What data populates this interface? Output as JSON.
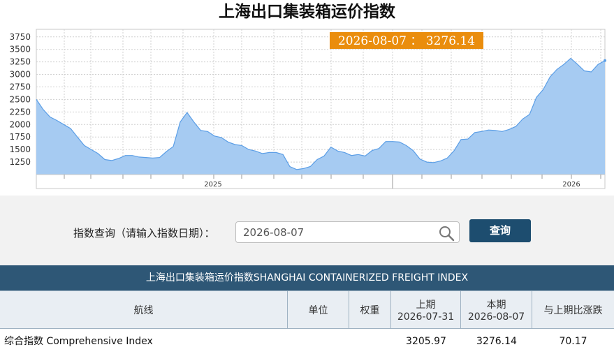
{
  "title": "上海出口集装箱运价指数",
  "chart_data": {
    "type": "area",
    "tooltip": "2026-08-07 ： 3276.14",
    "y_ticks": [
      "3750",
      "3500",
      "3250",
      "3000",
      "2750",
      "2500",
      "2250",
      "2000",
      "1750",
      "1500",
      "1250"
    ],
    "x_tick_labels": [
      "2025",
      "2026"
    ],
    "ylim": [
      1000,
      3900
    ],
    "grid": true,
    "fill_color": "#a6cbf2",
    "line_color": "#5b9ee6",
    "tooltip_color": "#ea8d0d",
    "values": [
      2500,
      2300,
      2150,
      2080,
      2000,
      1920,
      1750,
      1580,
      1500,
      1420,
      1300,
      1280,
      1320,
      1380,
      1380,
      1350,
      1340,
      1330,
      1340,
      1460,
      1560,
      2050,
      2240,
      2050,
      1880,
      1860,
      1770,
      1740,
      1650,
      1600,
      1580,
      1500,
      1470,
      1420,
      1440,
      1440,
      1400,
      1160,
      1100,
      1120,
      1160,
      1300,
      1370,
      1550,
      1470,
      1440,
      1380,
      1400,
      1370,
      1480,
      1520,
      1660,
      1660,
      1650,
      1580,
      1480,
      1310,
      1250,
      1240,
      1270,
      1330,
      1480,
      1700,
      1710,
      1840,
      1860,
      1890,
      1880,
      1860,
      1900,
      1960,
      2110,
      2200,
      2540,
      2700,
      2950,
      3100,
      3200,
      3320,
      3200,
      3070,
      3050,
      3200,
      3276
    ]
  },
  "query": {
    "label": "指数查询（请输入指数日期）：",
    "date_value": "2026-08-07",
    "button": "查询"
  },
  "table": {
    "header": "上海出口集装箱运价指数SHANGHAI CONTAINERIZED FREIGHT INDEX",
    "columns": {
      "route": "航线",
      "unit": "单位",
      "weight": "权重",
      "prev_label": "上期",
      "prev_date": "2026-07-31",
      "curr_label": "本期",
      "curr_date": "2026-08-07",
      "change": "与上期比涨跌"
    },
    "rows": [
      {
        "route": "综合指数 Comprehensive Index",
        "unit": "",
        "weight": "",
        "prev": "3205.97",
        "curr": "3276.14",
        "change": "70.17"
      }
    ]
  }
}
